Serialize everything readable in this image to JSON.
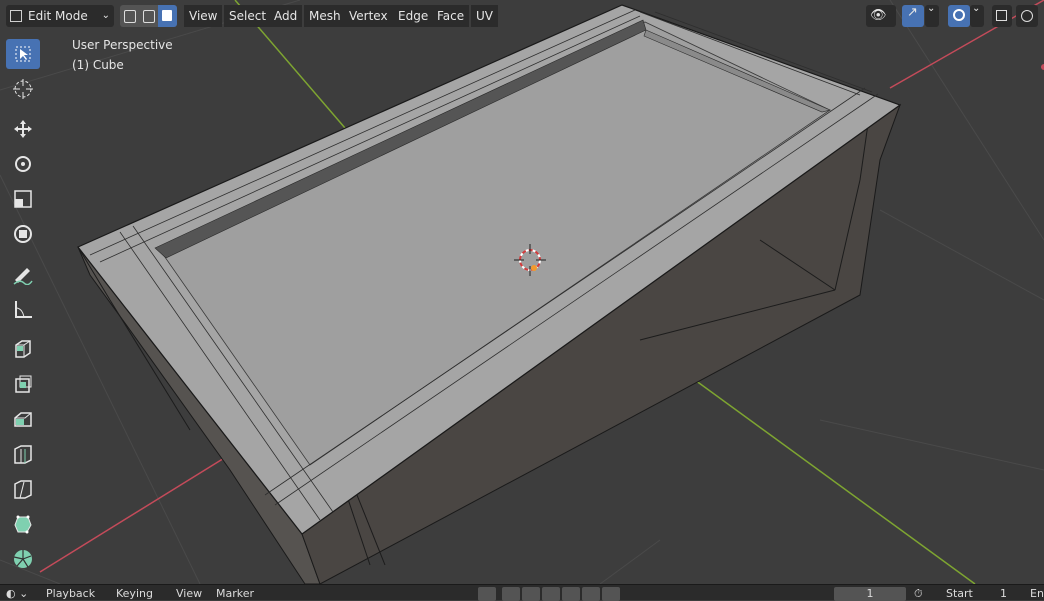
{
  "header": {
    "mode_label": "Edit Mode",
    "menus": [
      "View",
      "Select",
      "Add",
      "Mesh",
      "Vertex",
      "Edge",
      "Face",
      "UV"
    ]
  },
  "viewport": {
    "perspective_label": "User Perspective",
    "object_label": "(1) Cube"
  },
  "toolbar": {
    "tools": [
      "select-box",
      "cursor",
      "move",
      "rotate",
      "scale",
      "transform",
      "annotate",
      "measure",
      "add-cube",
      "extrude-region",
      "inset-faces",
      "bevel",
      "loop-cut",
      "knife",
      "poly-build",
      "spin"
    ]
  },
  "timeline": {
    "menus": [
      "Playback",
      "Keying",
      "View",
      "Marker"
    ],
    "current_frame": "1",
    "start_label": "Start",
    "start_value": "1",
    "end_label": "En"
  },
  "colors": {
    "background": "#3d3d3d",
    "header": "#2b2b2b",
    "accent": "#4772b3",
    "x_axis": "#c44b5a",
    "y_axis": "#7ea531",
    "mesh_top": "#a5a5a5",
    "mesh_side": "#4a4643"
  }
}
